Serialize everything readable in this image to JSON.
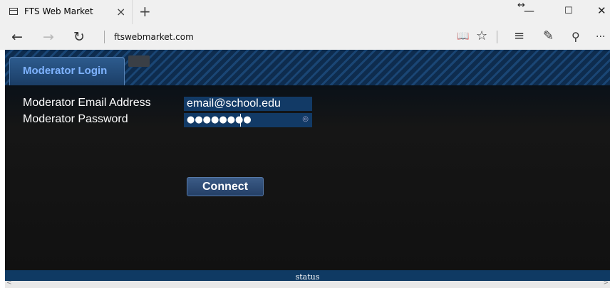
{
  "browser": {
    "tab_title": "FTS Web Market",
    "tab_close": "×",
    "new_tab": "+",
    "resize": "↔",
    "minimize": "—",
    "maximize": "☐",
    "close": "✕",
    "back": "←",
    "forward": "→",
    "refresh": "↻",
    "url": "ftswebmarket.com",
    "reading_view": "📖",
    "favorite": "☆",
    "hub": "≡",
    "web_note": "✎",
    "share": "⚲",
    "more": "···"
  },
  "header": {
    "tab_label": "Moderator Login"
  },
  "form": {
    "email_label": "Moderator Email Address",
    "email_value": "email@school.edu",
    "password_label": "Moderator Password",
    "password_value": "●●●●●●●●",
    "password_reveal": "◎",
    "connect_label": "Connect"
  },
  "status": {
    "text": "status"
  },
  "scroll": {
    "left": "<",
    "right": ">"
  }
}
